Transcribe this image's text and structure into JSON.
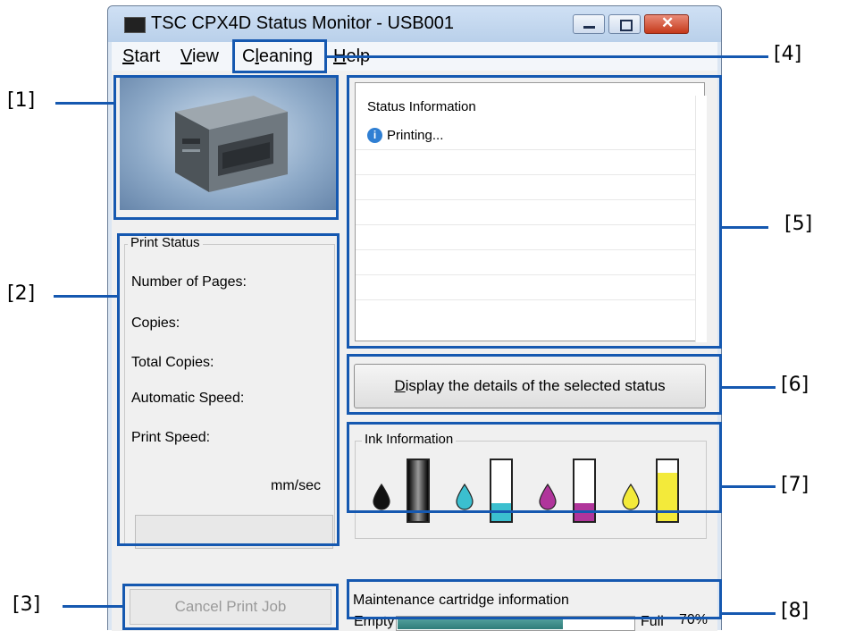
{
  "window": {
    "title": "TSC CPX4D Status Monitor - USB001",
    "controls": {
      "minimize": "—",
      "maximize": "□",
      "close": "✕"
    }
  },
  "menu": [
    {
      "label": "Start",
      "access_key": "S",
      "rest": "tart"
    },
    {
      "label": "View",
      "access_key": "V",
      "rest": "iew"
    },
    {
      "label": "Cleaning",
      "access_pre": "C",
      "access_key": "l",
      "rest": "eaning"
    },
    {
      "label": "Help",
      "access_key": "H",
      "rest": "elp"
    }
  ],
  "print_status": {
    "group_label": "Print Status",
    "number_of_pages_label": "Number of Pages:",
    "copies_label": "Copies:",
    "total_copies_label": "Total Copies:",
    "automatic_speed_label": "Automatic Speed:",
    "print_speed_label": "Print Speed:",
    "speed_unit": "mm/sec"
  },
  "cancel_button": "Cancel Print Job",
  "status_information": {
    "header": "Status Information",
    "entries": [
      {
        "icon": "info-icon",
        "text": "Printing..."
      }
    ]
  },
  "details_button": "Display the details of the selected status",
  "ink_information": {
    "group_label": "Ink Information",
    "inks": [
      {
        "name": "black",
        "color": "#111111",
        "level": 1.0
      },
      {
        "name": "cyan",
        "color": "#3bbfcf",
        "level": 0.3
      },
      {
        "name": "magenta",
        "color": "#b0359b",
        "level": 0.3
      },
      {
        "name": "yellow",
        "color": "#f3ea3a",
        "level": 0.8
      }
    ]
  },
  "maintenance": {
    "label": "Maintenance cartridge information",
    "empty_label": "Empty",
    "full_label": "Full",
    "percent_label": "70%",
    "level": 0.7
  },
  "callouts": [
    "[1]",
    "[2]",
    "[3]",
    "[4]",
    "[5]",
    "[6]",
    "[7]",
    "[8]"
  ],
  "colors": {
    "callout": "#1558b0",
    "close_button": "#c5391b",
    "accent": "#1a6fc9"
  }
}
